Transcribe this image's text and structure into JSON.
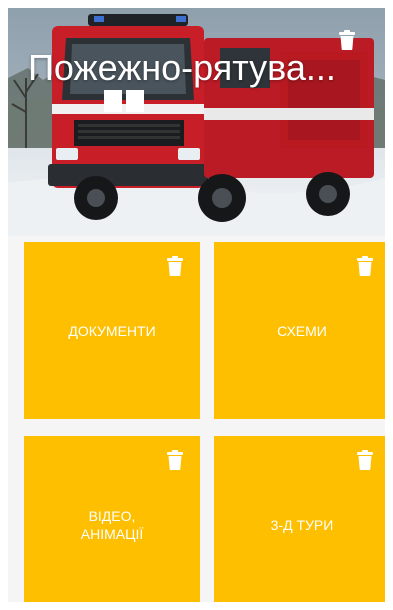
{
  "hero": {
    "title": "Пожежно-рятува...",
    "image": "fire-truck-photo",
    "delete_icon": "trash-icon"
  },
  "tiles": [
    {
      "label": "ДОКУМЕНТИ",
      "icon": "trash-icon"
    },
    {
      "label": "СХЕМИ",
      "icon": "trash-icon"
    },
    {
      "label": "ВІДЕО,\nАНІМАЦІЇ",
      "icon": "trash-icon"
    },
    {
      "label": "3-Д ТУРИ",
      "icon": "trash-icon"
    }
  ],
  "colors": {
    "tile": "#fdbf00",
    "label": "#ffffff",
    "truck_red": "#c81e28"
  }
}
